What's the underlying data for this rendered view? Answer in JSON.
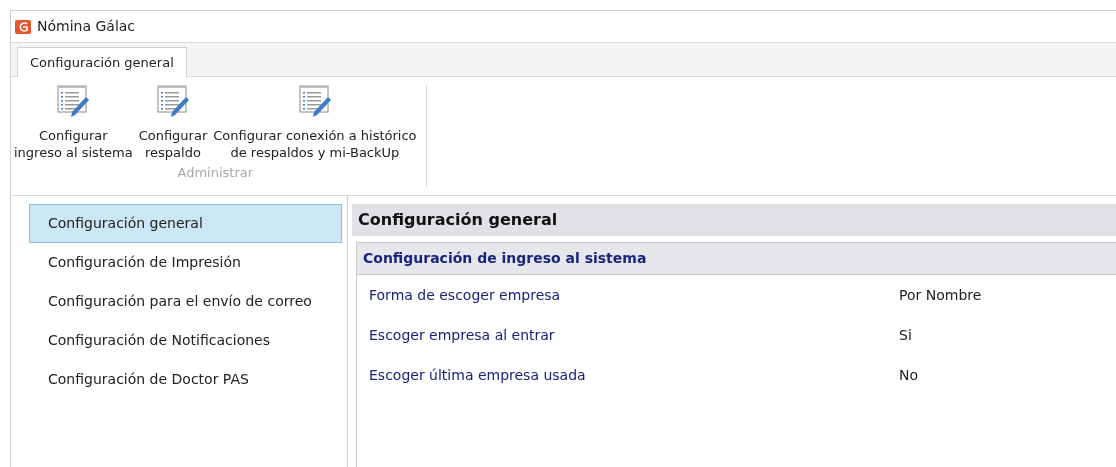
{
  "window": {
    "title": "Nómina Gálac"
  },
  "ribbon": {
    "tabs": [
      {
        "label": "Configuración general",
        "selected": true
      }
    ],
    "groups": [
      {
        "label": "Administrar",
        "buttons": [
          {
            "line1": "Configurar",
            "line2": "ingreso al sistema"
          },
          {
            "line1": "Configurar",
            "line2": "respaldo"
          },
          {
            "line1": "Configurar conexión a histórico",
            "line2": "de respaldos y mi-BackUp"
          }
        ]
      }
    ]
  },
  "sidebar": {
    "items": [
      {
        "label": "Configuración general",
        "selected": true
      },
      {
        "label": "Configuración de Impresión",
        "selected": false
      },
      {
        "label": "Configuración para el envío de correo",
        "selected": false
      },
      {
        "label": "Configuración de Notificaciones",
        "selected": false
      },
      {
        "label": "Configuración de Doctor PAS",
        "selected": false
      }
    ]
  },
  "content": {
    "title": "Configuración general",
    "section": {
      "title": "Configuración de ingreso al sistema",
      "rows": [
        {
          "label": "Forma de escoger empresa",
          "value": "Por Nombre"
        },
        {
          "label": "Escoger empresa al entrar",
          "value": "Si"
        },
        {
          "label": "Escoger última empresa usada",
          "value": "No"
        }
      ]
    }
  }
}
